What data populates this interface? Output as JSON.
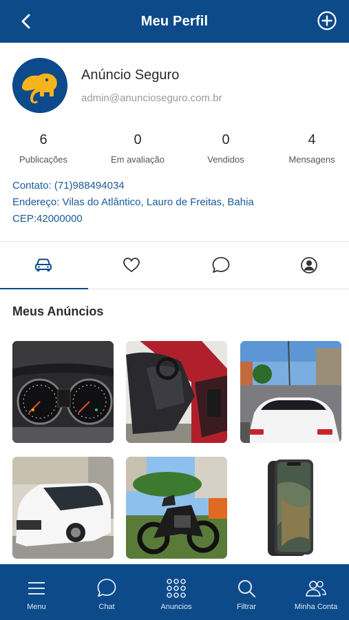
{
  "header": {
    "title": "Meu Perfil",
    "back_icon": "chevron-left-icon",
    "add_icon": "plus-circle-icon"
  },
  "profile": {
    "name": "Anúncio Seguro",
    "email": "admin@anuncioseguro.com.br",
    "avatar_icon": "elephant-logo",
    "stats": [
      {
        "value": "6",
        "label": "Publicações"
      },
      {
        "value": "0",
        "label": "Em avaliação"
      },
      {
        "value": "0",
        "label": "Vendidos"
      },
      {
        "value": "4",
        "label": "Mensagens"
      }
    ],
    "contact": "Contato: (71)988494034",
    "address": "Endereço: Vilas do Atlântico, Lauro de Freitas, Bahia",
    "cep": "CEP:42000000"
  },
  "tabs": [
    {
      "icon": "car-icon",
      "active": true
    },
    {
      "icon": "heart-icon",
      "active": false
    },
    {
      "icon": "chat-bubble-icon",
      "active": false
    },
    {
      "icon": "user-circle-icon",
      "active": false
    }
  ],
  "section": {
    "title": "Meus Anúncios"
  },
  "ads": [
    {
      "image": "car-dashboard-photo"
    },
    {
      "image": "red-car-interior-photo"
    },
    {
      "image": "white-sedan-street-photo"
    },
    {
      "image": "white-hatchback-photo"
    },
    {
      "image": "motorcycle-photo"
    },
    {
      "image": "smartphone-photo"
    }
  ],
  "bottom_nav": [
    {
      "label": "Menu",
      "icon": "hamburger-icon"
    },
    {
      "label": "Chat",
      "icon": "chat-icon"
    },
    {
      "label": "Anuncios",
      "icon": "grid-dots-icon"
    },
    {
      "label": "Filtrar",
      "icon": "search-icon"
    },
    {
      "label": "Minha Conta",
      "icon": "users-icon"
    }
  ],
  "colors": {
    "primary": "#0c4a8a",
    "link": "#1a5a97",
    "avatar_bg": "#0d4a8c",
    "logo": "#f5b41b"
  }
}
